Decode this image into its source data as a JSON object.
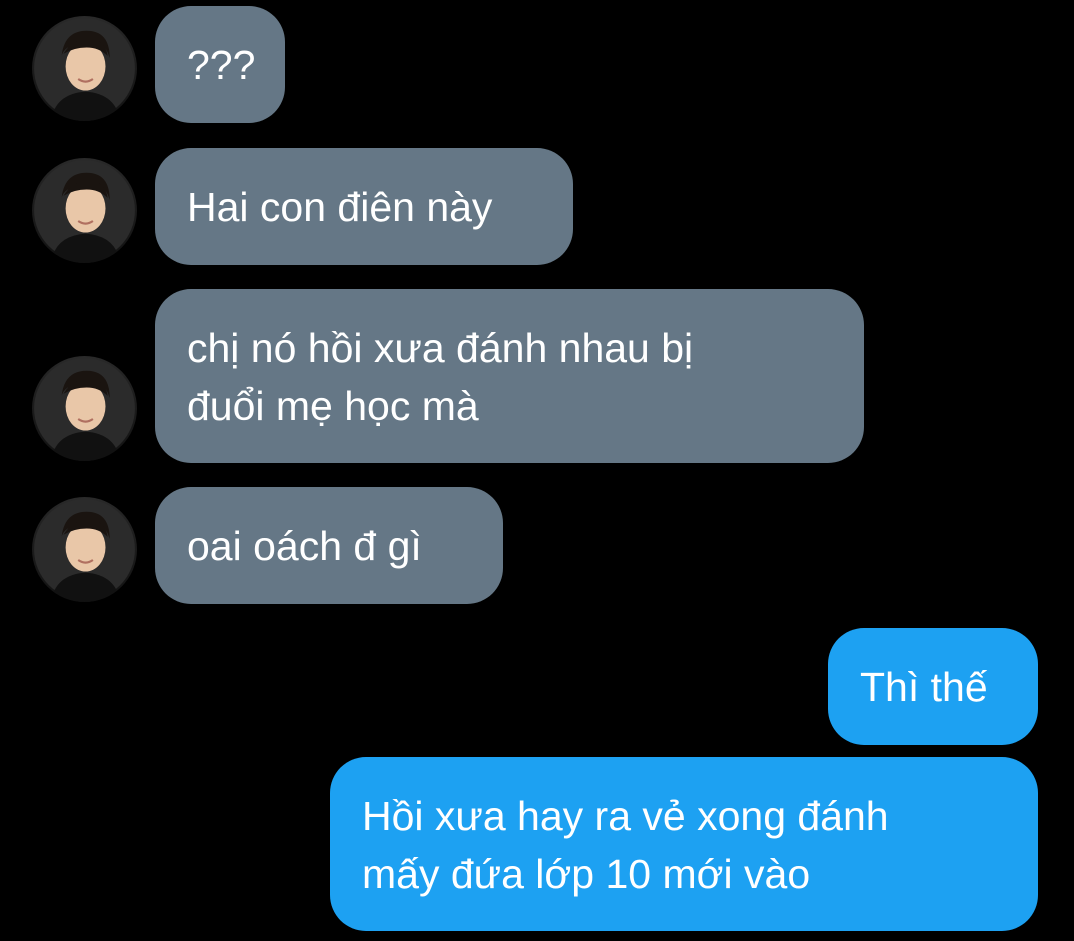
{
  "colors": {
    "background": "#000000",
    "received_bubble": "#657786",
    "sent_bubble": "#1da1f2",
    "text": "#ffffff"
  },
  "messages": [
    {
      "direction": "received",
      "text": "???"
    },
    {
      "direction": "received",
      "text": "Hai con điên này"
    },
    {
      "direction": "received",
      "text": "chị nó hồi xưa đánh nhau bị\nđuổi mẹ học mà"
    },
    {
      "direction": "received",
      "text": "oai oách đ gì"
    },
    {
      "direction": "sent",
      "text": "Thì thế"
    },
    {
      "direction": "sent",
      "text": "Hồi xưa hay ra vẻ xong đánh\nmấy đứa lớp 10 mới vào"
    }
  ],
  "avatar_icon": "profile-photo-icon"
}
